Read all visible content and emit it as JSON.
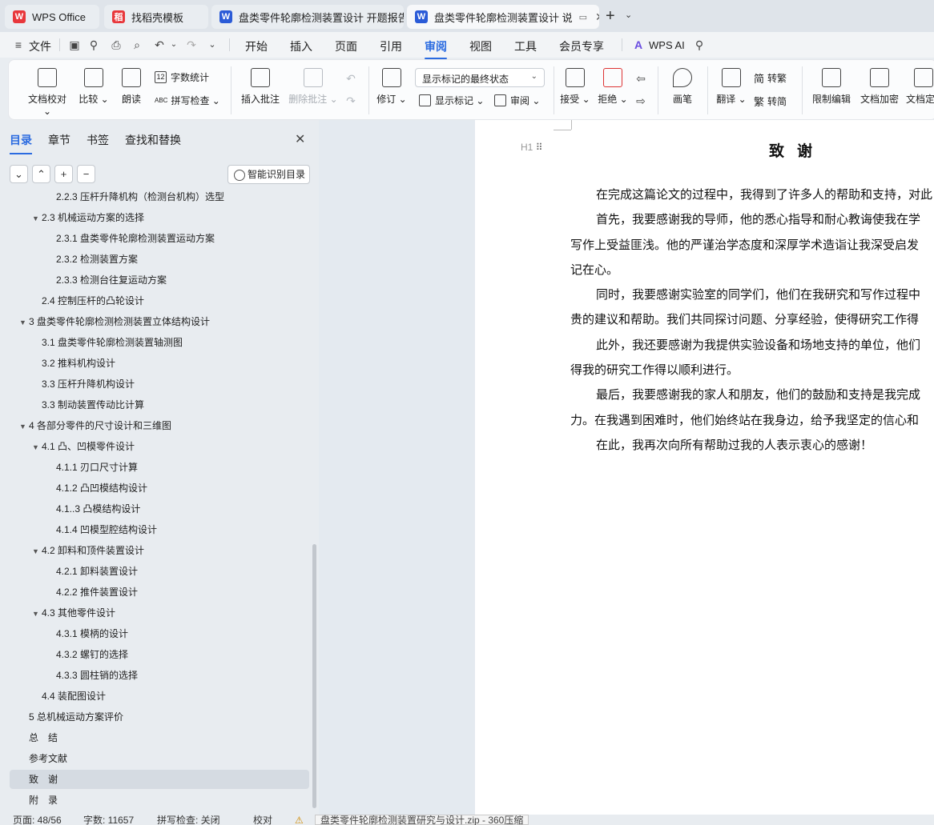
{
  "tabs": [
    {
      "label": "WPS Office",
      "icon": "wps-logo-icon"
    },
    {
      "label": "找稻壳模板",
      "icon": "daoke-icon"
    },
    {
      "label": "盘类零件轮廓检测装置设计 开题报告.",
      "icon": "word-doc-icon"
    },
    {
      "label": "盘类零件轮廓检测装置设计 说",
      "icon": "word-doc-icon"
    }
  ],
  "menu": {
    "file": "文件",
    "items": [
      "开始",
      "插入",
      "页面",
      "引用",
      "审阅",
      "视图",
      "工具",
      "会员专享"
    ],
    "active": "审阅",
    "ai": "WPS AI"
  },
  "ribbon": {
    "doc_check": "文档校对",
    "compare": "比较",
    "read_aloud": "朗读",
    "word_count": "字数统计",
    "spell_check": "拼写检查",
    "insert_comment": "插入批注",
    "delete_comment": "删除批注",
    "revise": "修订",
    "markup_state": "显示标记的最终状态",
    "show_markup": "显示标记",
    "review": "审阅",
    "accept": "接受",
    "reject": "拒绝",
    "brush": "画笔",
    "translate": "翻译",
    "to_traditional": "转繁",
    "to_simplified": "转简",
    "restrict_edit": "限制编辑",
    "doc_encrypt": "文档加密",
    "doc_final": "文档定"
  },
  "nav": {
    "tabs": [
      "目录",
      "章节",
      "书签",
      "查找和替换"
    ],
    "smart_toc": "智能识别目录",
    "toc": [
      {
        "text": "2.2.3 压杆升降机构（检测台机构）选型",
        "level": 3,
        "expand": ""
      },
      {
        "text": "2.3 机械运动方案的选择",
        "level": 2,
        "expand": "▼"
      },
      {
        "text": "2.3.1 盘类零件轮廓检测装置运动方案",
        "level": 3,
        "expand": ""
      },
      {
        "text": "2.3.2 检测装置方案",
        "level": 3,
        "expand": ""
      },
      {
        "text": "2.3.3 检测台往复运动方案",
        "level": 3,
        "expand": ""
      },
      {
        "text": "2.4 控制压杆的凸轮设计",
        "level": 2,
        "expand": ""
      },
      {
        "text": "3 盘类零件轮廓检测检测装置立体结构设计",
        "level": 1,
        "expand": "▼"
      },
      {
        "text": "3.1 盘类零件轮廓检测装置轴测图",
        "level": 2,
        "expand": ""
      },
      {
        "text": "3.2 推料机构设计",
        "level": 2,
        "expand": ""
      },
      {
        "text": "3.3 压杆升降机构设计",
        "level": 2,
        "expand": ""
      },
      {
        "text": "3.3 制动装置传动比计算",
        "level": 2,
        "expand": ""
      },
      {
        "text": "4 各部分零件的尺寸设计和三维图",
        "level": 1,
        "expand": "▼"
      },
      {
        "text": "4.1 凸、凹模零件设计",
        "level": 2,
        "expand": "▼"
      },
      {
        "text": "4.1.1 刃口尺寸计算",
        "level": 3,
        "expand": ""
      },
      {
        "text": "4.1.2 凸凹模结构设计",
        "level": 3,
        "expand": ""
      },
      {
        "text": "4.1..3 凸模结构设计",
        "level": 3,
        "expand": ""
      },
      {
        "text": "4.1.4 凹模型腔结构设计",
        "level": 3,
        "expand": ""
      },
      {
        "text": "4.2 卸料和顶件装置设计",
        "level": 2,
        "expand": "▼"
      },
      {
        "text": "4.2.1 卸料装置设计",
        "level": 3,
        "expand": ""
      },
      {
        "text": "4.2.2 推件装置设计",
        "level": 3,
        "expand": ""
      },
      {
        "text": "4.3 其他零件设计",
        "level": 2,
        "expand": "▼"
      },
      {
        "text": "4.3.1 模柄的设计",
        "level": 3,
        "expand": ""
      },
      {
        "text": "4.3.2 螺钉的选择",
        "level": 3,
        "expand": ""
      },
      {
        "text": "4.3.3 圆柱销的选择",
        "level": 3,
        "expand": ""
      },
      {
        "text": "4.4 装配图设计",
        "level": 2,
        "expand": ""
      },
      {
        "text": "5 总机械运动方案评价",
        "level": 1,
        "expand": ""
      },
      {
        "text": "总　结",
        "level": 1,
        "expand": ""
      },
      {
        "text": "参考文献",
        "level": 1,
        "expand": ""
      },
      {
        "text": "致　谢",
        "level": 1,
        "expand": "",
        "selected": true
      },
      {
        "text": "附　录",
        "level": 1,
        "expand": ""
      }
    ]
  },
  "document": {
    "heading_mark": "H1",
    "heading": "致谢",
    "paragraphs": [
      "在完成这篇论文的过程中，我得到了许多人的帮助和支持，对此",
      "首先，我要感谢我的导师，他的悉心指导和耐心教诲使我在学",
      "写作上受益匪浅。他的严谨治学态度和深厚学术造诣让我深受启发",
      "记在心。",
      "同时，我要感谢实验室的同学们，他们在我研究和写作过程中",
      "贵的建议和帮助。我们共同探讨问题、分享经验，使得研究工作得",
      "此外，我还要感谢为我提供实验设备和场地支持的单位，他们",
      "得我的研究工作得以顺利进行。",
      "最后，我要感谢我的家人和朋友，他们的鼓励和支持是我完成",
      "力。在我遇到困难时，他们始终站在我身边，给予我坚定的信心和",
      "在此，我再次向所有帮助过我的人表示衷心的感谢！"
    ],
    "indented": [
      true,
      true,
      false,
      false,
      true,
      false,
      true,
      false,
      true,
      false,
      true
    ]
  },
  "status": {
    "page": "页面: 48/56",
    "words": "字数: 11657",
    "spell": "拼写检查: 关闭",
    "proof": "校对",
    "tooltip": "盘类零件轮廓检测装置研究与设计.zip - 360压缩"
  },
  "colors": {
    "accent": "#2b6be0",
    "wps_red": "#e8373b",
    "word_blue": "#2b5bd7"
  }
}
